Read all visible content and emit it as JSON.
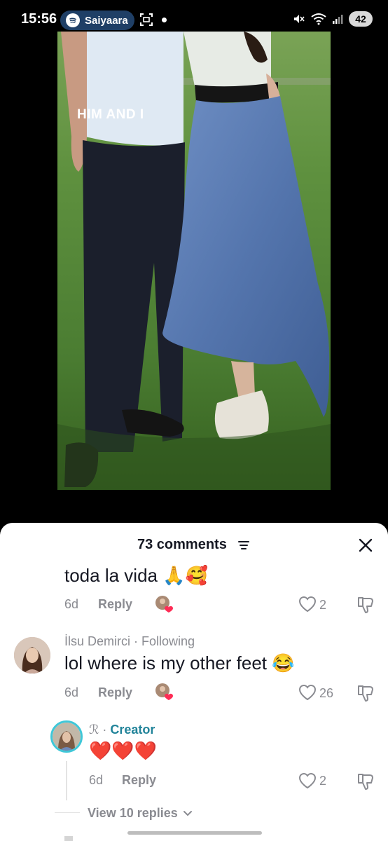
{
  "status_bar": {
    "time": "15:56",
    "now_playing": "Saiyaara",
    "battery": "42",
    "icons": [
      "spotify-icon",
      "screen-record-icon",
      "mute-icon",
      "wifi-icon",
      "signal-icon",
      "battery-icon"
    ]
  },
  "video": {
    "caption": "HIM AND I"
  },
  "comments_sheet": {
    "title": "73 comments",
    "comments": [
      {
        "text": "toda la vida 🙏🥰",
        "time": "6d",
        "reply_label": "Reply",
        "likes": "2"
      },
      {
        "author": "İlsu Demirci",
        "relation": "Following",
        "text": "lol where is my other feet 😂",
        "time": "6d",
        "reply_label": "Reply",
        "likes": "26"
      },
      {
        "author": "ℛ",
        "badge": "Creator",
        "text": "❤️❤️❤️",
        "time": "6d",
        "reply_label": "Reply",
        "likes": "2"
      }
    ],
    "view_replies": "View 10 replies"
  },
  "colors": {
    "creator_accent": "#22849a",
    "muted_text": "#8a8b91",
    "primary_text": "#161823",
    "liked_heart": "#fe2c55"
  }
}
